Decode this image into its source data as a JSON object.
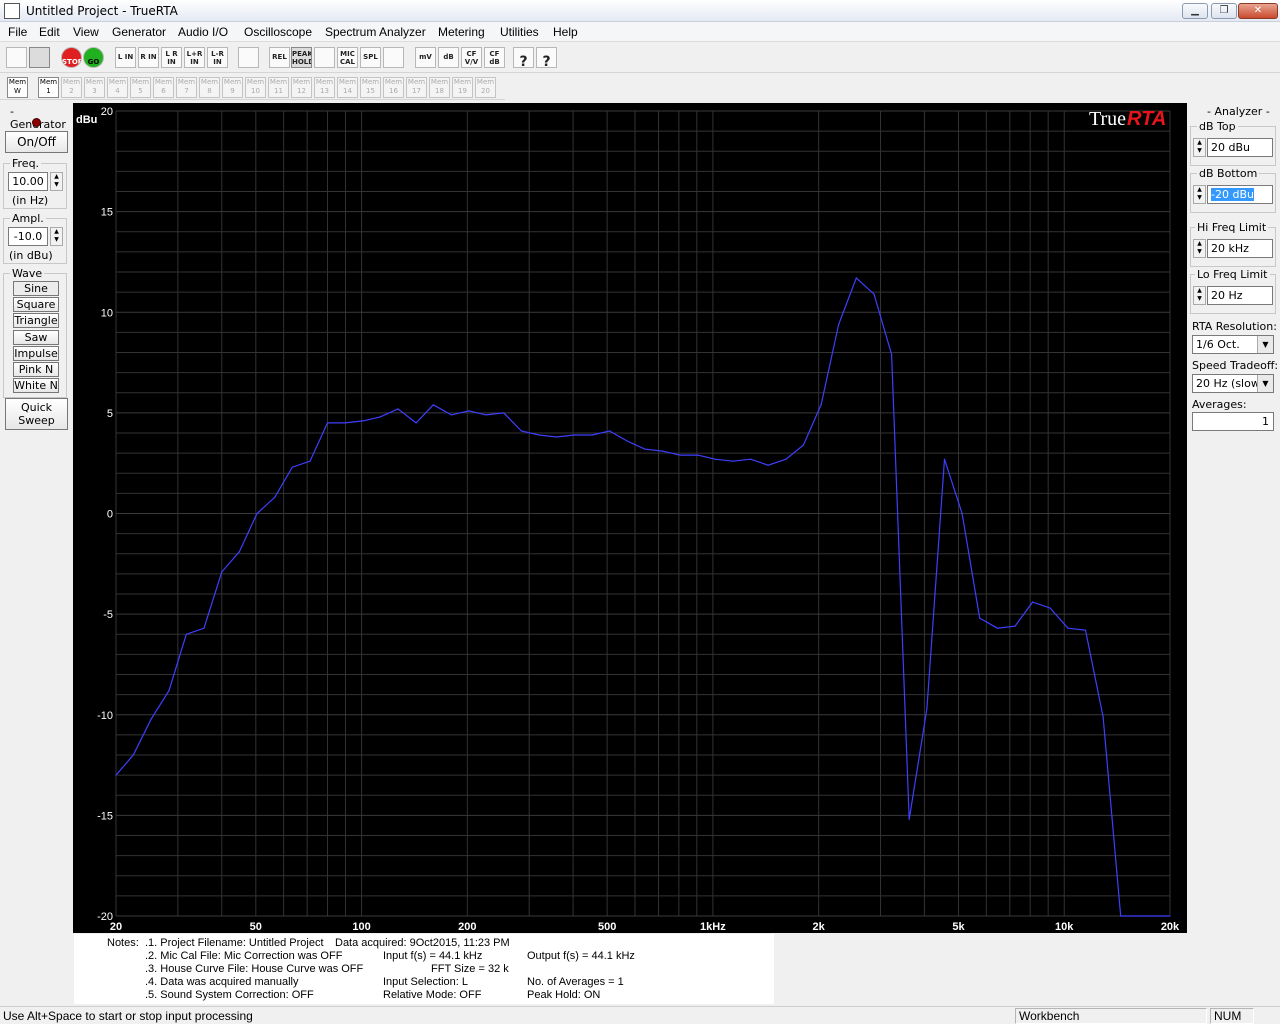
{
  "window": {
    "title": "Untitled Project - TrueRTA",
    "min_glyph": "▁",
    "max_glyph": "❐",
    "close_glyph": "✕"
  },
  "menu": [
    "File",
    "Edit",
    "View",
    "Generator",
    "Audio I/O",
    "Oscilloscope",
    "Spectrum Analyzer",
    "Metering",
    "Utilities",
    "Help"
  ],
  "toolbar": {
    "buttons": [
      {
        "name": "sine-wave-icon",
        "label": ""
      },
      {
        "name": "spectrum-view-icon",
        "label": ""
      },
      {
        "name": "stop-button",
        "label": "STOP"
      },
      {
        "name": "go-button",
        "label": "GO"
      },
      {
        "name": "left-in-button",
        "label": "L IN"
      },
      {
        "name": "right-in-button",
        "label": "R IN"
      },
      {
        "name": "left-right-in-button",
        "label": "L R IN"
      },
      {
        "name": "l-plus-r-in-button",
        "label": "L+R IN"
      },
      {
        "name": "l-minus-r-in-button",
        "label": "L-R IN"
      },
      {
        "name": "grid-icon",
        "label": ""
      },
      {
        "name": "rel-button",
        "label": "REL"
      },
      {
        "name": "peak-hold-button",
        "label": "PEAK HOLD"
      },
      {
        "name": "bars-icon",
        "label": ""
      },
      {
        "name": "mic-cal-button",
        "label": "MIC CAL"
      },
      {
        "name": "spl-button",
        "label": "SPL"
      },
      {
        "name": "cancel-icon",
        "label": ""
      },
      {
        "name": "mv-button",
        "label": "mV"
      },
      {
        "name": "db-button",
        "label": "dB"
      },
      {
        "name": "cf-vv-button",
        "label": "CF V/V"
      },
      {
        "name": "cf-db-button",
        "label": "CF dB"
      },
      {
        "name": "help-icon",
        "label": "?"
      },
      {
        "name": "context-help-icon",
        "label": "?"
      }
    ],
    "mem_w_label": "Mem W",
    "mem_labels": [
      "Mem 1",
      "Mem 2",
      "Mem 3",
      "Mem 4",
      "Mem 5",
      "Mem 6",
      "Mem 7",
      "Mem 8",
      "Mem 9",
      "Mem 10",
      "Mem 11",
      "Mem 12",
      "Mem 13",
      "Mem 14",
      "Mem 15",
      "Mem 16",
      "Mem 17",
      "Mem 18",
      "Mem 19",
      "Mem 20"
    ]
  },
  "generator": {
    "title": "- Generator -",
    "on_off": "On/Off",
    "freq_label": "Freq.",
    "freq_value": "10.00",
    "freq_unit": "(in Hz)",
    "ampl_label": "Ampl.",
    "ampl_value": "-10.0",
    "ampl_unit": "(in dBu)",
    "wave_label": "Wave",
    "waves": [
      "Sine",
      "Square",
      "Triangle",
      "Saw",
      "Impulse",
      "Pink N",
      "White N"
    ],
    "quick_sweep": [
      "Quick",
      "Sweep"
    ]
  },
  "analyzer": {
    "title": "- Analyzer -",
    "db_top_label": "dB Top",
    "db_top_value": "20 dBu",
    "db_bottom_label": "dB Bottom",
    "db_bottom_value": "-20 dBu",
    "hi_freq_label": "Hi Freq Limit",
    "hi_freq_value": "20 kHz",
    "lo_freq_label": "Lo Freq Limit",
    "lo_freq_value": "20 Hz",
    "rta_res_label": "RTA Resolution:",
    "rta_res_value": "1/6 Oct.",
    "speed_label": "Speed Tradeoff:",
    "speed_value": "20 Hz (slow)",
    "averages_label": "Averages:",
    "averages_value": "1"
  },
  "chart_data": {
    "type": "line",
    "brand": "True",
    "brand_accent": "RTA",
    "ylabel": "dBu",
    "x_scale": "log",
    "xlim": [
      20,
      20000
    ],
    "ylim": [
      -20,
      20
    ],
    "y_ticks": [
      20,
      15,
      10,
      5,
      0,
      -5,
      -10,
      -15,
      -20
    ],
    "y_tick_labels": [
      "20",
      "15",
      "10",
      "5",
      "0",
      "-5",
      "-10",
      "-15",
      "-20"
    ],
    "x_ticks": [
      20,
      50,
      100,
      200,
      500,
      1000,
      2000,
      5000,
      10000,
      20000
    ],
    "x_tick_labels": [
      "20",
      "50",
      "100",
      "200",
      "500",
      "1kHz",
      "2k",
      "5k",
      "10k",
      "20k"
    ],
    "grid": true,
    "colors": {
      "background": "#000000",
      "grid": "#333333",
      "line": "#3f3fff",
      "axis_text": "#ffffff",
      "brand_true": "#ffffff",
      "brand_rta": "#e8141c"
    },
    "series": [
      {
        "x": [
          20,
          22.4,
          25.2,
          28.3,
          31.7,
          35.6,
          40,
          44.9,
          50.4,
          56.6,
          63.5,
          71.3,
          80,
          89.8,
          101,
          113,
          127,
          143,
          160,
          180,
          202,
          226,
          254,
          285,
          320,
          359,
          403,
          453,
          508,
          570,
          640,
          718,
          806,
          905,
          1016,
          1140,
          1280,
          1437,
          1613,
          1810,
          2032,
          2281,
          2560,
          2874,
          3225,
          3620,
          4064,
          4561,
          5120,
          5747,
          6451,
          7241,
          8127,
          9123,
          10240,
          11494,
          12902,
          14482,
          16255,
          18246,
          20000
        ],
        "y": [
          -13,
          -12,
          -10.2,
          -8.8,
          -6,
          -5.7,
          -2.9,
          -1.9,
          0,
          0.8,
          2.3,
          2.6,
          4.5,
          4.5,
          4.6,
          4.8,
          5.2,
          4.5,
          5.4,
          4.9,
          5.1,
          4.9,
          5.0,
          4.1,
          3.9,
          3.8,
          3.9,
          3.9,
          4.1,
          3.6,
          3.2,
          3.1,
          2.9,
          2.9,
          2.7,
          2.6,
          2.7,
          2.4,
          2.7,
          3.4,
          5.4,
          9.4,
          11.7,
          10.9,
          7.9,
          -15.2,
          -9.7,
          2.7,
          0,
          -5.2,
          -5.7,
          -5.6,
          -4.4,
          -4.7,
          -5.7,
          -5.8,
          -10.1,
          -20,
          -20,
          -20,
          -20
        ]
      }
    ]
  },
  "notes": {
    "label": "Notes:",
    "line1": ".1. Project Filename: Untitled Project",
    "acquired": "Data acquired: 9Oct2015, 11:23 PM",
    "line2": ".2. Mic Cal File: Mic Correction was OFF",
    "input_fs": "Input f(s) = 44.1 kHz",
    "output_fs": "Output f(s) = 44.1 kHz",
    "line3": ".3. House Curve File: House Curve was OFF",
    "fft": "FFT Size = 32 k",
    "line4": ".4. Data was acquired manually",
    "input_sel": "Input Selection: L",
    "averages": "No. of Averages = 1",
    "line5": ".5. Sound System Correction: OFF",
    "rel_mode": "Relative Mode:  OFF",
    "peak_hold": "Peak Hold: ON"
  },
  "status": {
    "hint": "Use Alt+Space to start or stop input processing",
    "mode": "Workbench",
    "num": "NUM"
  }
}
